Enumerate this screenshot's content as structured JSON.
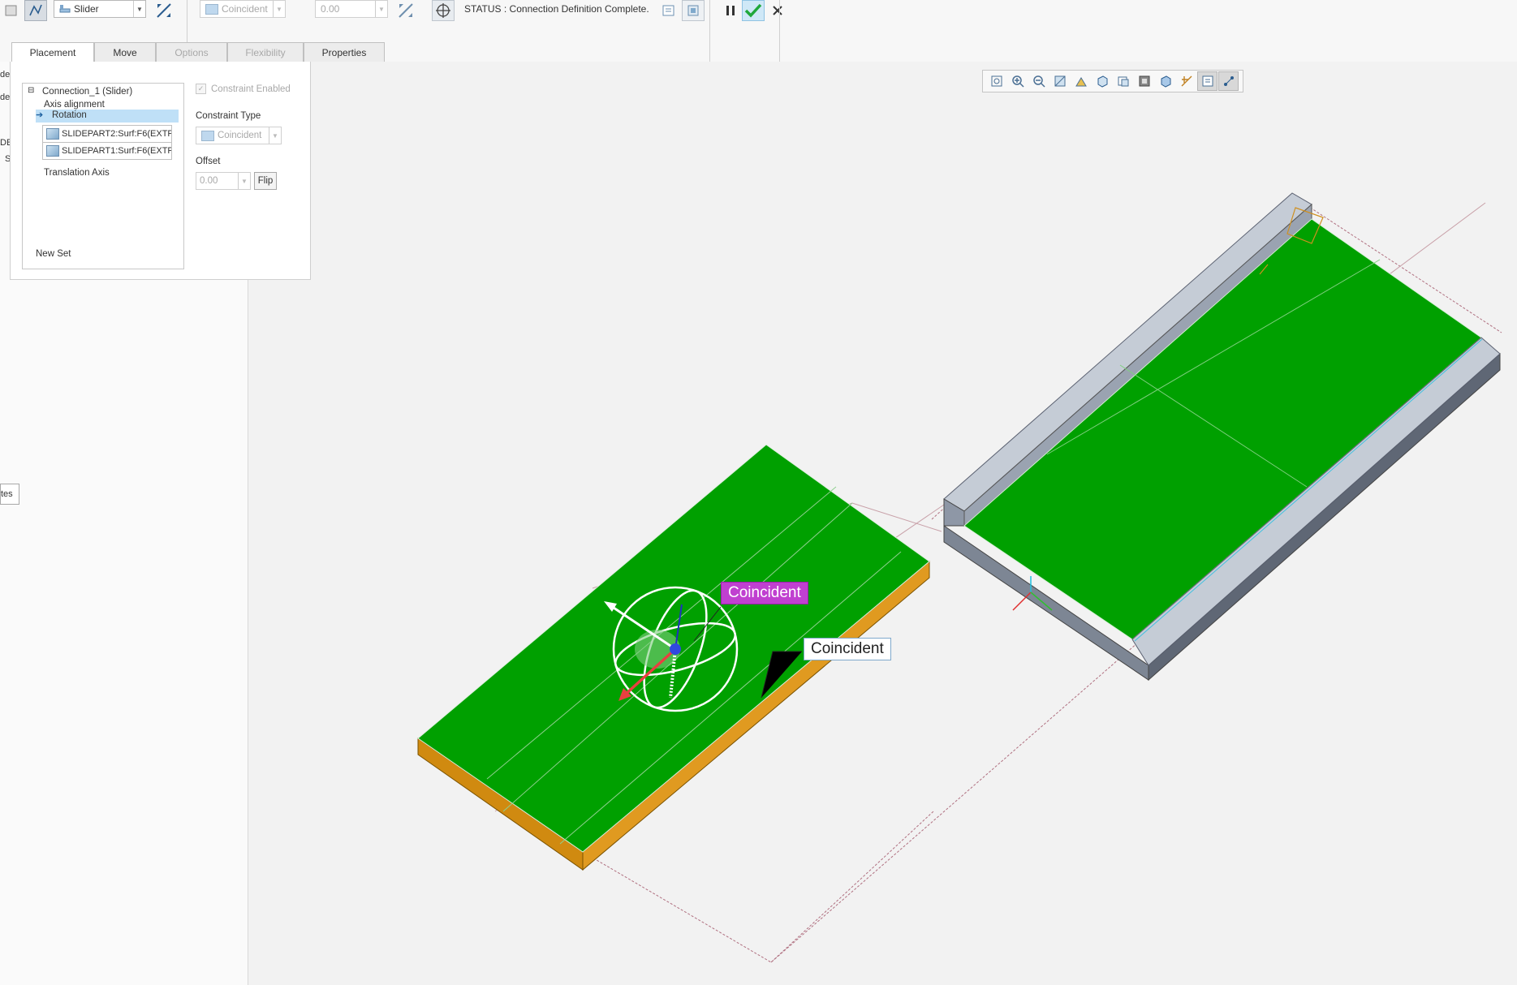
{
  "toolbar": {
    "connection_type": "Slider",
    "constraint_type": "Coincident",
    "offset_value": "0.00",
    "status_text": "STATUS : Connection Definition Complete."
  },
  "tabs": [
    {
      "label": "Placement",
      "active": true
    },
    {
      "label": "Move",
      "active": false
    },
    {
      "label": "Options",
      "active": false,
      "disabled": true
    },
    {
      "label": "Flexibility",
      "active": false,
      "disabled": true
    },
    {
      "label": "Properties",
      "active": false
    }
  ],
  "placement": {
    "tree": {
      "connection": "Connection_1 (Slider)",
      "axis_alignment": "Axis alignment",
      "rotation": "Rotation",
      "refs": [
        "SLIDEPART2:Surf:F6(EXTF",
        "SLIDEPART1:Surf:F6(EXTF"
      ],
      "translation_axis": "Translation Axis",
      "new_set": "New Set"
    },
    "constraint_enabled_label": "Constraint Enabled",
    "constraint_type_label": "Constraint Type",
    "constraint_type_value": "Coincident",
    "offset_label": "Offset",
    "offset_value": "0.00",
    "flip_label": "Flip"
  },
  "left_panel_fragments": [
    "de",
    "del",
    "DE",
    "S",
    "tes"
  ],
  "viewport": {
    "labels": [
      {
        "text": "Coincident",
        "style": "magenta"
      },
      {
        "text": "Coincident",
        "style": "white"
      }
    ]
  },
  "colors": {
    "accent_green": "#00a000",
    "part_edge_orange": "#cf8a10",
    "channel_gray": "#8a96a8",
    "tag_magenta": "#c040d0",
    "ok_check": "#1fa83a"
  },
  "icons": {
    "ok": "checkmark-icon",
    "pause": "pause-icon",
    "cancel": "close-icon"
  }
}
